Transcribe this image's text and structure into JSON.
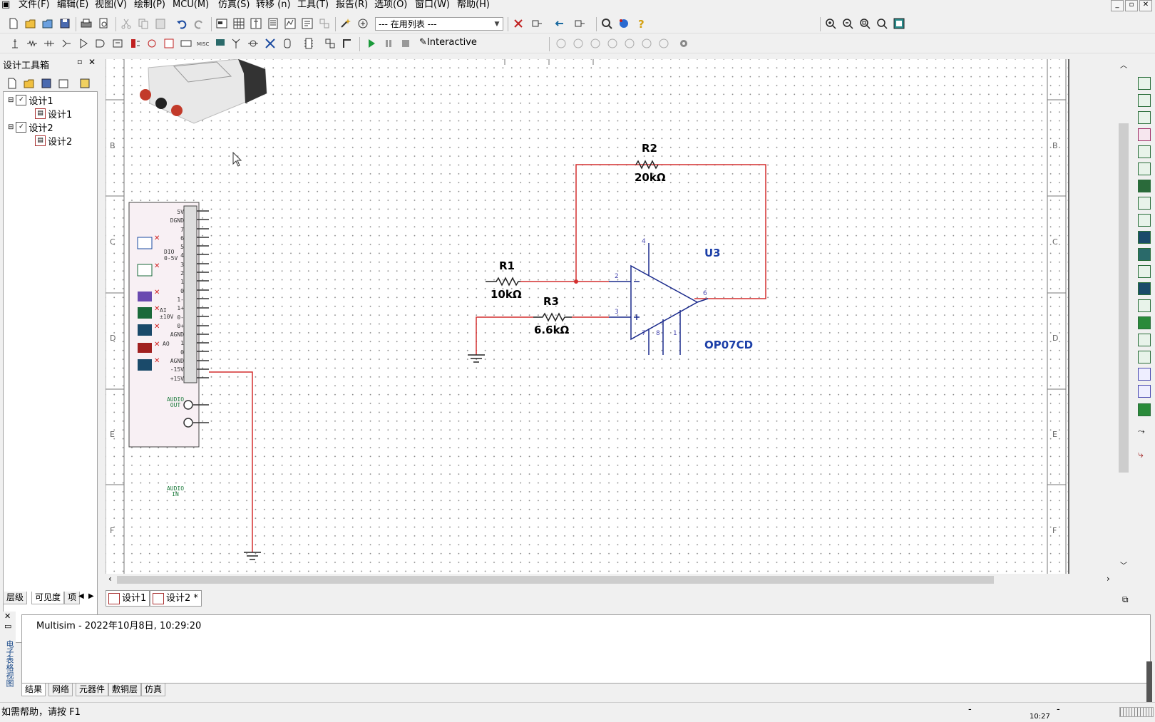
{
  "menubar": {
    "items": [
      "文件(F)",
      "编辑(E)",
      "视图(V)",
      "绘制(P)",
      "MCU(M)",
      "仿真(S)",
      "转移 (n)",
      "工具(T)",
      "报告(R)",
      "选项(O)",
      "窗口(W)",
      "帮助(H)"
    ],
    "window_controls": [
      "_",
      "▫",
      "✕"
    ]
  },
  "toolbar": {
    "in_use_list": "--- 在用列表 ---",
    "sim_mode": "Interactive"
  },
  "design_toolbox": {
    "title": "设计工具箱",
    "tree": [
      {
        "label": "设计1",
        "level": 0
      },
      {
        "label": "设计1",
        "level": 1
      },
      {
        "label": "设计2",
        "level": 0
      },
      {
        "label": "设计2",
        "level": 1
      }
    ],
    "tabs": [
      "层级",
      "可见度",
      "项"
    ]
  },
  "schematic": {
    "border_rows": [
      "B",
      "C",
      "D",
      "E",
      "F"
    ],
    "components": {
      "r1": {
        "ref": "R1",
        "value": "10kΩ"
      },
      "r2": {
        "ref": "R2",
        "value": "20kΩ"
      },
      "r3": {
        "ref": "R3",
        "value": "6.6kΩ"
      },
      "opamp": {
        "ref": "U3",
        "model": "OP07CD",
        "pins": [
          "4",
          "2",
          "3",
          "6",
          "7",
          "8",
          "1"
        ]
      }
    },
    "mydaq_labels": [
      "5V",
      "DGND",
      "7",
      "6",
      "5",
      "4",
      "3",
      "2",
      "1",
      "0",
      "1-",
      "1+",
      "0-",
      "0+",
      "AGND",
      "1",
      "0",
      "AGND",
      "-15V",
      "+15V"
    ],
    "mydaq_groups": [
      "DIO 0-5V",
      "AI ±10V",
      "AO",
      "AUDIO OUT",
      "AUDIO IN"
    ]
  },
  "document_tabs": [
    "设计1",
    "设计2 *"
  ],
  "output": {
    "side_label": "电子表格视图",
    "log": "Multisim  -  2022年10月8日, 10:29:20",
    "tabs": [
      "结果",
      "网络",
      "元器件",
      "敷铜层",
      "仿真"
    ]
  },
  "status": {
    "help": "如需帮助，请按 F1",
    "sep1": "-",
    "sep2": "-",
    "time": "10:27"
  },
  "colors": {
    "wire": "#d42f2f",
    "component": "#1a2a8c",
    "label_blue": "#1c3fa8",
    "pin_text": "#4a4ab0"
  }
}
